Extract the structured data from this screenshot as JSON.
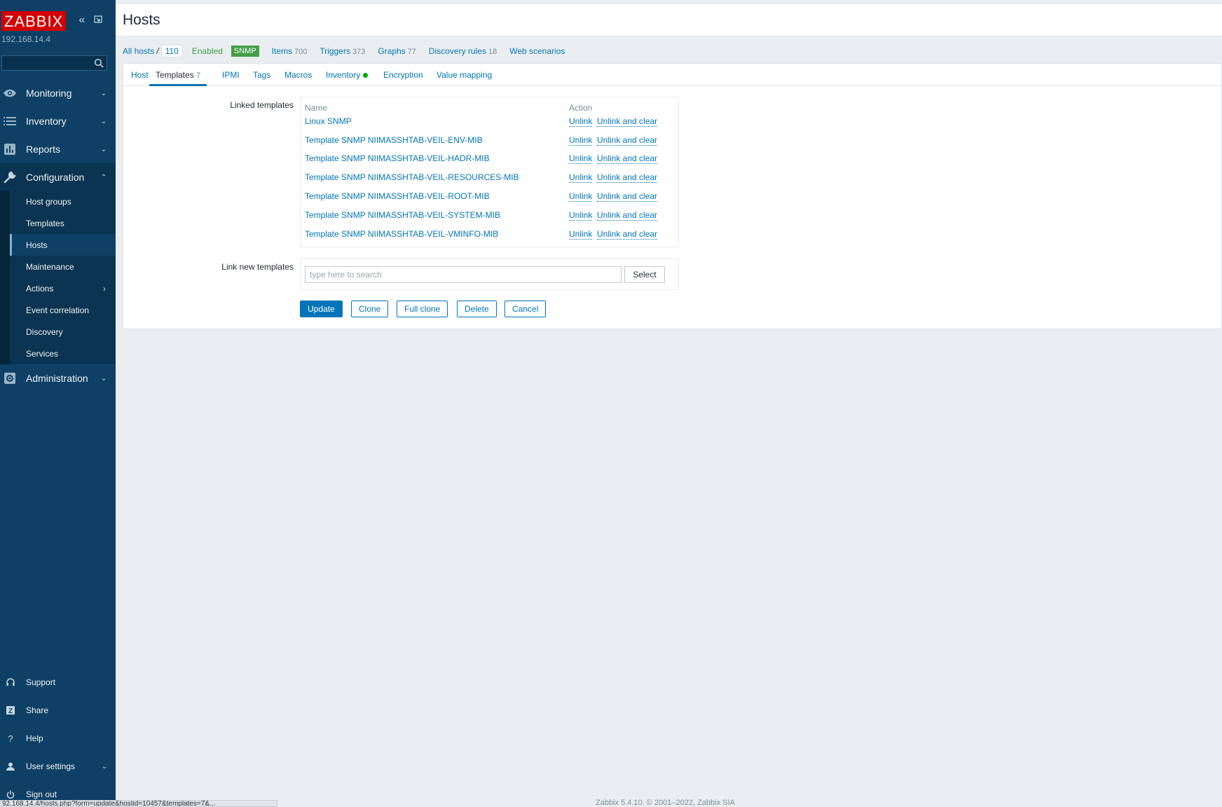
{
  "sidebar": {
    "logo": "ZABBIX",
    "server": "192.168.14.4",
    "search_placeholder": "",
    "menu": [
      {
        "label": "Monitoring",
        "icon": "eye-icon"
      },
      {
        "label": "Inventory",
        "icon": "list-icon"
      },
      {
        "label": "Reports",
        "icon": "bar-chart-icon"
      },
      {
        "label": "Configuration",
        "icon": "wrench-icon"
      },
      {
        "label": "Administration",
        "icon": "gear-icon"
      }
    ],
    "configuration_items": [
      "Host groups",
      "Templates",
      "Hosts",
      "Maintenance",
      "Actions",
      "Event correlation",
      "Discovery",
      "Services"
    ],
    "bottom": [
      {
        "label": "Support",
        "icon": "headset-icon"
      },
      {
        "label": "Share",
        "icon": "share-icon"
      },
      {
        "label": "Help",
        "icon": "help-icon"
      },
      {
        "label": "User settings",
        "icon": "user-icon"
      },
      {
        "label": "Sign out",
        "icon": "power-icon"
      }
    ]
  },
  "header": {
    "title": "Hosts"
  },
  "breadcrumb": {
    "all_hosts": "All hosts",
    "separator": "/",
    "host_count": "110",
    "status": "Enabled",
    "badge": "SNMP",
    "items_label": "Items",
    "items_count": "700",
    "triggers_label": "Triggers",
    "triggers_count": "373",
    "graphs_label": "Graphs",
    "graphs_count": "77",
    "discovery_label": "Discovery rules",
    "discovery_count": "18",
    "web_label": "Web scenarios"
  },
  "tabs": {
    "host": "Host",
    "templates": "Templates",
    "templates_count": "7",
    "ipmi": "IPMI",
    "tags": "Tags",
    "macros": "Macros",
    "inventory": "Inventory",
    "encryption": "Encryption",
    "value_mapping": "Value mapping"
  },
  "linked_templates": {
    "label": "Linked templates",
    "col_name": "Name",
    "col_action": "Action",
    "unlink": "Unlink",
    "unlink_clear": "Unlink and clear",
    "rows": [
      "Linux SNMP",
      "Template SNMP NIIMASSHTAB-VEIL-ENV-MIB",
      "Template SNMP NIIMASSHTAB-VEIL-HADR-MIB",
      "Template SNMP NIIMASSHTAB-VEIL-RESOURCES-MIB",
      "Template SNMP NIIMASSHTAB-VEIL-ROOT-MIB",
      "Template SNMP NIIMASSHTAB-VEIL-SYSTEM-MIB",
      "Template SNMP NIIMASSHTAB-VEIL-VMINFO-MIB"
    ]
  },
  "link_new": {
    "label": "Link new templates",
    "placeholder": "type here to search",
    "select": "Select"
  },
  "buttons": {
    "update": "Update",
    "clone": "Clone",
    "full_clone": "Full clone",
    "delete": "Delete",
    "cancel": "Cancel"
  },
  "footer": "Zabbix 5.4.10. © 2001–2022, Zabbix SIA",
  "statusbar": "92.168.14.4/hosts.php?form=update&hostid=10457&templates=7&...",
  "colors": {
    "sidebar": "#0e4065",
    "link": "#0275b8",
    "logo": "#d40000",
    "enabled": "#429e47"
  }
}
